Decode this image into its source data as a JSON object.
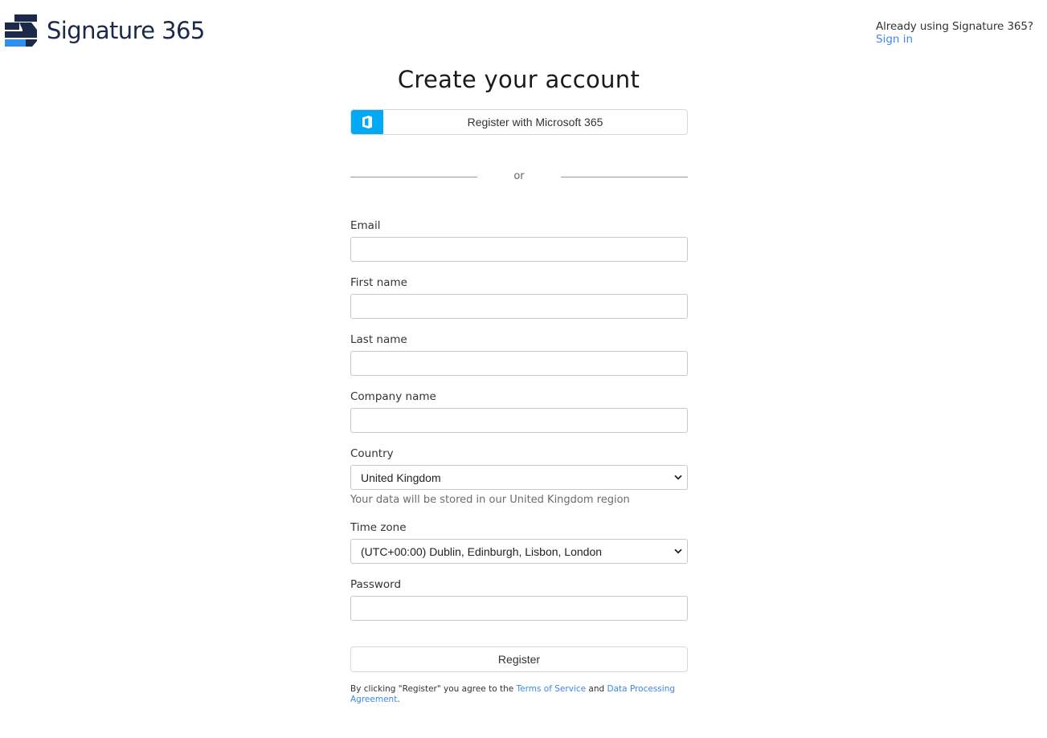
{
  "brand": {
    "name": "Signature 365",
    "colors": {
      "dark": "#1b2a4a",
      "accent": "#2f8ff0",
      "link": "#3d86f0",
      "microsoft_blue": "#03a9f4"
    }
  },
  "header": {
    "signin_prompt": "Already using Signature 365?",
    "signin_link": "Sign in"
  },
  "page": {
    "title": "Create your account"
  },
  "microsoft": {
    "button_label": "Register with Microsoft 365",
    "icon": "office-icon"
  },
  "divider": {
    "label": "or"
  },
  "form": {
    "email": {
      "label": "Email",
      "value": "",
      "placeholder": ""
    },
    "first_name": {
      "label": "First name",
      "value": "",
      "placeholder": ""
    },
    "last_name": {
      "label": "Last name",
      "value": "",
      "placeholder": ""
    },
    "company_name": {
      "label": "Company name",
      "value": "",
      "placeholder": ""
    },
    "country": {
      "label": "Country",
      "selected": "United Kingdom",
      "help": "Your data will be stored in our United Kingdom region"
    },
    "time_zone": {
      "label": "Time zone",
      "selected": "(UTC+00:00) Dublin, Edinburgh, Lisbon, London"
    },
    "password": {
      "label": "Password",
      "value": "",
      "placeholder": ""
    }
  },
  "register": {
    "label": "Register"
  },
  "terms": {
    "prefix": "By clicking \"Register\" you agree to the",
    "terms_link": "Terms of Service",
    "and": "and",
    "dpa_link": "Data Processing Agreement",
    "suffix": "."
  }
}
